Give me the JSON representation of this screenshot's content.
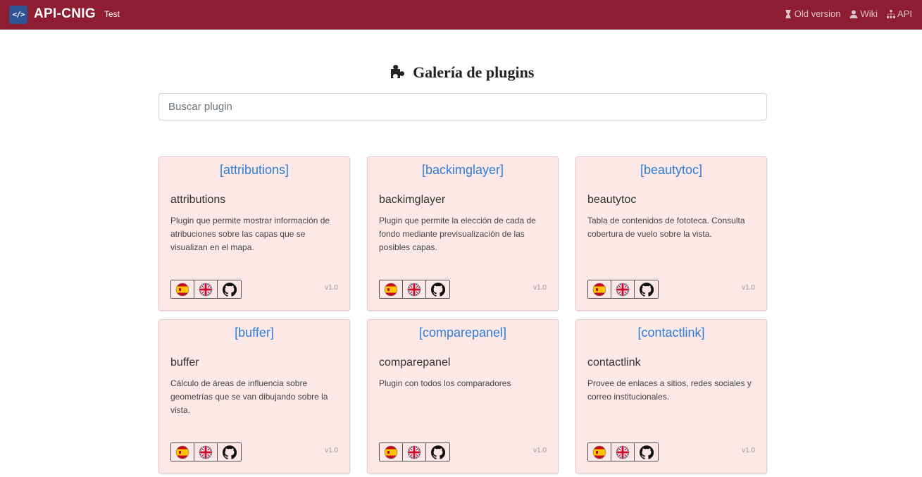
{
  "navbar": {
    "logo_text": "</>",
    "brand": "API-CNIG",
    "env": "Test",
    "links": [
      {
        "label": "Old version",
        "icon": "hourglass-icon"
      },
      {
        "label": "Wiki",
        "icon": "user-icon"
      },
      {
        "label": "API",
        "icon": "sitemap-icon"
      }
    ]
  },
  "page": {
    "title": "Galería de plugins",
    "search_placeholder": "Buscar plugin"
  },
  "plugins": [
    {
      "link": "[attributions]",
      "name": "attributions",
      "description": "Plugin que permite mostrar información de atribuciones sobre las capas que se visualizan en el mapa.",
      "version": "v1.0"
    },
    {
      "link": "[backimglayer]",
      "name": "backimglayer",
      "description": "Plugin que permite la elección de cada de fondo mediante previsualización de las posibles capas.",
      "version": "v1.0"
    },
    {
      "link": "[beautytoc]",
      "name": "beautytoc",
      "description": "Tabla de contenidos de fototeca. Consulta cobertura de vuelo sobre la vista.",
      "version": "v1.0"
    },
    {
      "link": "[buffer]",
      "name": "buffer",
      "description": "Cálculo de áreas de influencia sobre geometrías que se van dibujando sobre la vista.",
      "version": "v1.0"
    },
    {
      "link": "[comparepanel]",
      "name": "comparepanel",
      "description": "Plugin con todos los comparadores",
      "version": "v1.0"
    },
    {
      "link": "[contactlink]",
      "name": "contactlink",
      "description": "Provee de enlaces a sitios, redes sociales y correo institucionales.",
      "version": "v1.0"
    }
  ],
  "colors": {
    "navbar": "#8e1d31",
    "card_bg": "#fde8e8",
    "link": "#2e7cd6"
  }
}
